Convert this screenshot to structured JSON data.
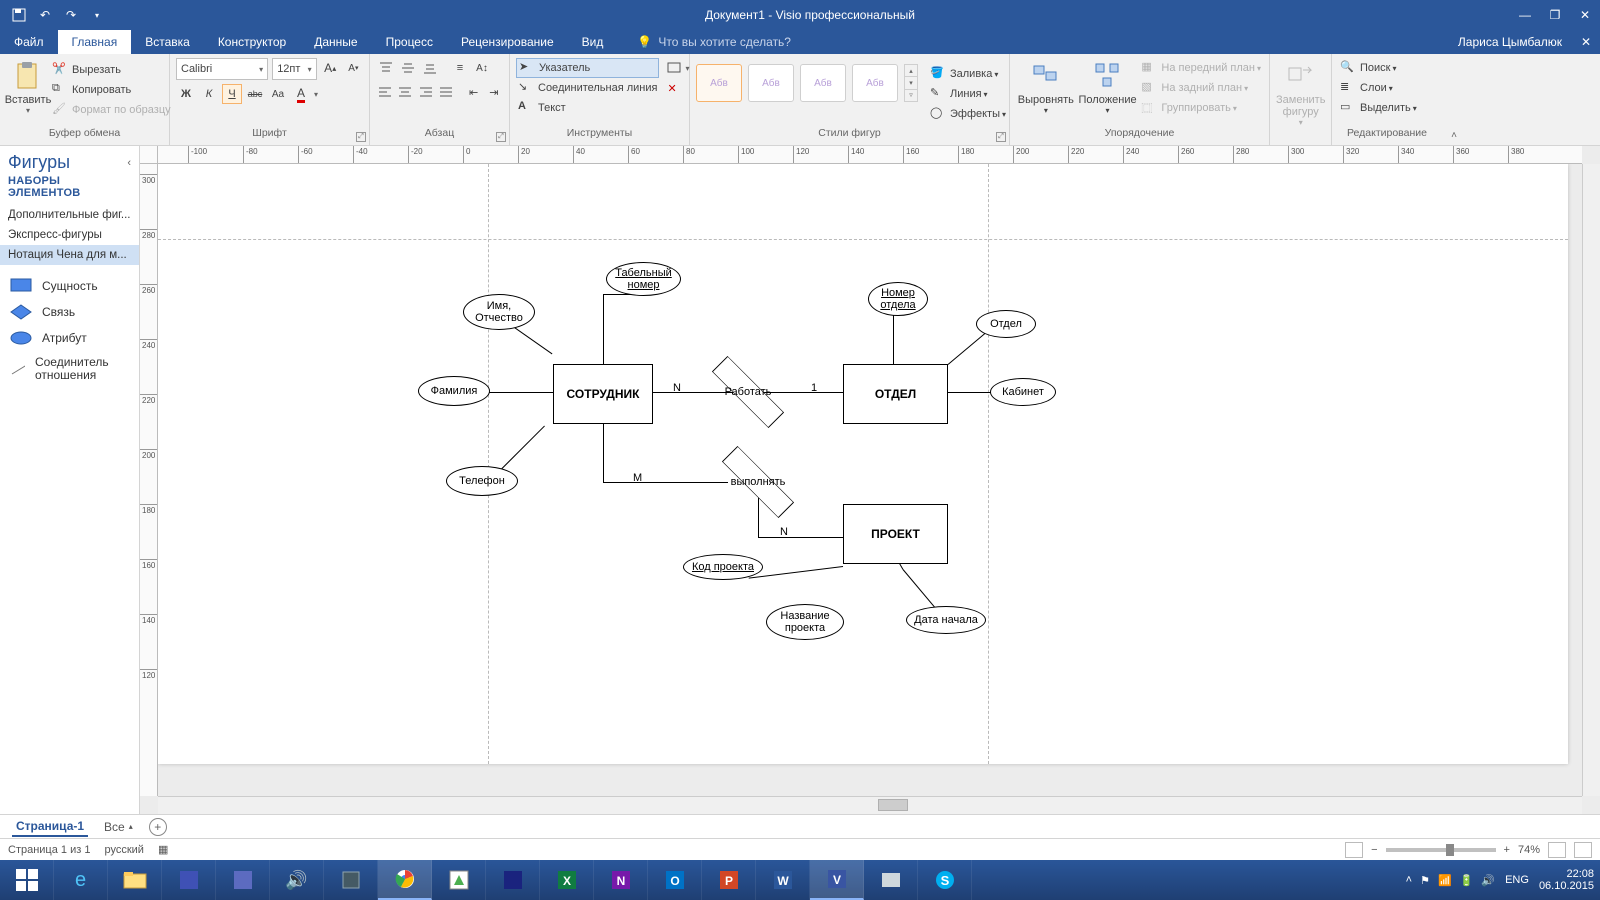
{
  "titlebar": {
    "doc_title": "Документ1 - Visio профессиональный"
  },
  "tabs": {
    "file": "Файл",
    "items": [
      "Главная",
      "Вставка",
      "Конструктор",
      "Данные",
      "Процесс",
      "Рецензирование",
      "Вид"
    ],
    "active": "Главная",
    "tell_me": "Что вы хотите сделать?",
    "user": "Лариса Цымбалюк"
  },
  "ribbon": {
    "clipboard": {
      "paste": "Вставить",
      "cut": "Вырезать",
      "copy": "Копировать",
      "format_painter": "Формат по образцу",
      "label": "Буфер обмена"
    },
    "font": {
      "family": "Calibri",
      "size": "12пт",
      "bold": "Ж",
      "italic": "К",
      "underline": "Ч",
      "strike": "abc",
      "case": "Aa",
      "label": "Шрифт"
    },
    "para": {
      "label": "Абзац"
    },
    "tools": {
      "pointer": "Указатель",
      "connector": "Соединительная линия",
      "text": "Текст",
      "label": "Инструменты"
    },
    "styles": {
      "sample": "Абв",
      "label": "Стили фигур",
      "fill": "Заливка",
      "line": "Линия",
      "effects": "Эффекты"
    },
    "arrange": {
      "align": "Выровнять",
      "position": "Положение",
      "front": "На передний план",
      "back": "На задний план",
      "group": "Группировать",
      "label": "Упорядочение"
    },
    "change": {
      "change_shape": "Заменить фигуру",
      "label": ""
    },
    "editing": {
      "find": "Поиск",
      "layers": "Слои",
      "select": "Выделить",
      "label": "Редактирование"
    }
  },
  "shapes": {
    "title": "Фигуры",
    "sets": "НАБОРЫ ЭЛЕМЕНТОВ",
    "stencils": [
      "Дополнительные фиг...",
      "Экспресс-фигуры",
      "Нотация Чена для м..."
    ],
    "active_stencil": "Нотация Чена для м...",
    "list": {
      "entity": "Сущность",
      "relation": "Связь",
      "attribute": "Атрибут",
      "connector": "Соединитель отношения"
    }
  },
  "ruler_h": [
    "-100",
    "-80",
    "-60",
    "-40",
    "-20",
    "0",
    "20",
    "40",
    "60",
    "80",
    "100",
    "120",
    "140",
    "160",
    "180",
    "200",
    "220",
    "240",
    "260",
    "280",
    "300",
    "320",
    "340",
    "360",
    "380"
  ],
  "ruler_v": [
    "300",
    "280",
    "260",
    "240",
    "220",
    "200",
    "180",
    "160",
    "140",
    "120"
  ],
  "diagram": {
    "entities": {
      "employee": "СОТРУДНИК",
      "department": "ОТДЕЛ",
      "project": "ПРОЕКТ"
    },
    "relations": {
      "work": "Работать",
      "perform": "выполнять"
    },
    "attrs": {
      "tab_no": "Табельный номер",
      "name": "Имя, Отчество",
      "surname": "Фамилия",
      "phone": "Телефон",
      "dept_no": "Номер отдела",
      "dept": "Отдел",
      "room": "Кабинет",
      "proj_code": "Код проекта",
      "proj_name": "Название проекта",
      "start": "Дата начала"
    },
    "card": {
      "n": "N",
      "one": "1",
      "m": "M"
    }
  },
  "page_tabs": {
    "page1": "Страница-1",
    "all": "Все"
  },
  "status": {
    "pages": "Страница 1 из 1",
    "lang": "русский",
    "zoom": "74%"
  },
  "taskbar": {
    "lang": "ENG",
    "time": "22:08",
    "date": "06.10.2015"
  }
}
